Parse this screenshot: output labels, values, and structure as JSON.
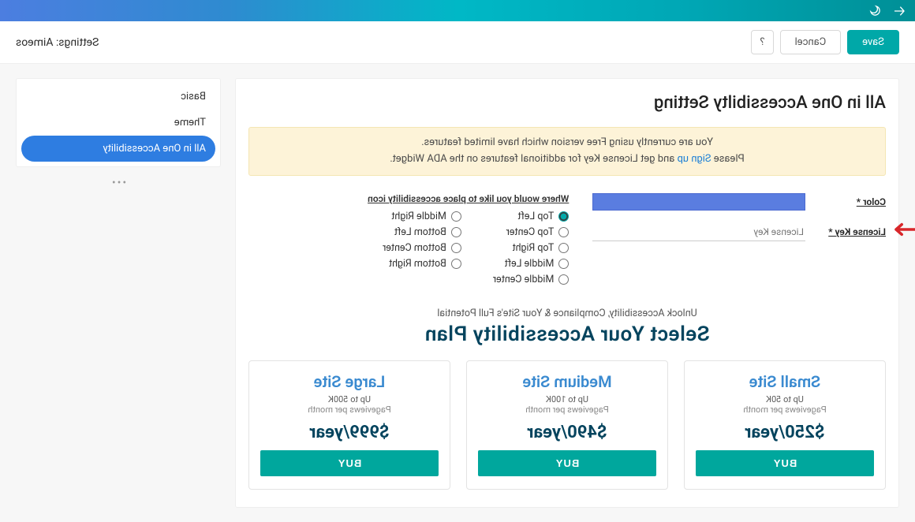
{
  "breadcrumb": "Settings: Aimeos",
  "actions": {
    "save": "Save",
    "cancel": "Cancel",
    "help": "?"
  },
  "sidebar": {
    "items": [
      {
        "label": "Basic",
        "active": false
      },
      {
        "label": "Theme",
        "active": false
      },
      {
        "label": "All in One Accessibility",
        "active": true
      }
    ],
    "more": "•••"
  },
  "main": {
    "title": "All in One Accessibilty Setting",
    "notice_line1": "You are currently using Free version which have limited features.",
    "notice_line2_before": "Please ",
    "notice_line2_link": "Sign up",
    "notice_line2_after": " and get License Key for additional features on the ADA Widget.",
    "color_label": "Color *",
    "license_label": "License Key *",
    "license_placeholder": "License Key",
    "position_heading": "Where would you like to place accessibility icon",
    "color_value": "#5a7de0",
    "positions_col1": [
      {
        "value": "top-left",
        "label": "Top Left",
        "checked": true
      },
      {
        "value": "top-center",
        "label": "Top Center",
        "checked": false
      },
      {
        "value": "top-right",
        "label": "Top Right",
        "checked": false
      },
      {
        "value": "middle-left",
        "label": "Middle Left",
        "checked": false
      },
      {
        "value": "middle-center",
        "label": "Middle Center",
        "checked": false
      }
    ],
    "positions_col2": [
      {
        "value": "middle-right",
        "label": "Middle Right",
        "checked": false
      },
      {
        "value": "bottom-left",
        "label": "Bottom Left",
        "checked": false
      },
      {
        "value": "bottom-center",
        "label": "Bottom Center",
        "checked": false
      },
      {
        "value": "bottom-right",
        "label": "Bottom Right",
        "checked": false
      }
    ],
    "plans_sub": "Unlock Accessibility, Compliance & Your Site's Full Potential",
    "plans_title": "Select Your Accessibility Plan",
    "plans": [
      {
        "name": "Small Site",
        "up": "Up to 50K",
        "pv": "Pageviews per month",
        "price": "$250/year",
        "buy": "BUY"
      },
      {
        "name": "Medium Site",
        "up": "Up to 100K",
        "pv": "Pageviews per month",
        "price": "$490/year",
        "buy": "BUY"
      },
      {
        "name": "Large Site",
        "up": "Up to 500K",
        "pv": "Pageviews per month",
        "price": "$999/year",
        "buy": "BUY"
      }
    ]
  }
}
